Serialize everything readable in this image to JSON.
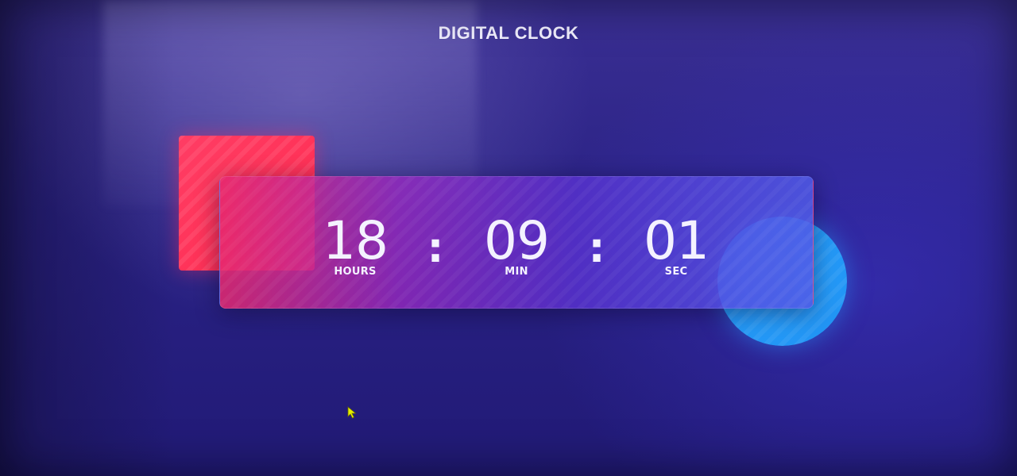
{
  "page": {
    "title": "DIGITAL CLOCK"
  },
  "clock": {
    "hours": "18",
    "minutes": "09",
    "seconds": "01",
    "separator": ":",
    "labels": {
      "hours": "HOURS",
      "minutes": "MIN",
      "seconds": "SEC"
    }
  },
  "colors": {
    "background": "#2a2285",
    "red_shape": "#ff2a4f",
    "blue_shape": "#1d8ff2",
    "text": "#f4f2ff",
    "cursor": "#e6f000"
  },
  "icons": {
    "cursor": "mouse-pointer-icon"
  }
}
